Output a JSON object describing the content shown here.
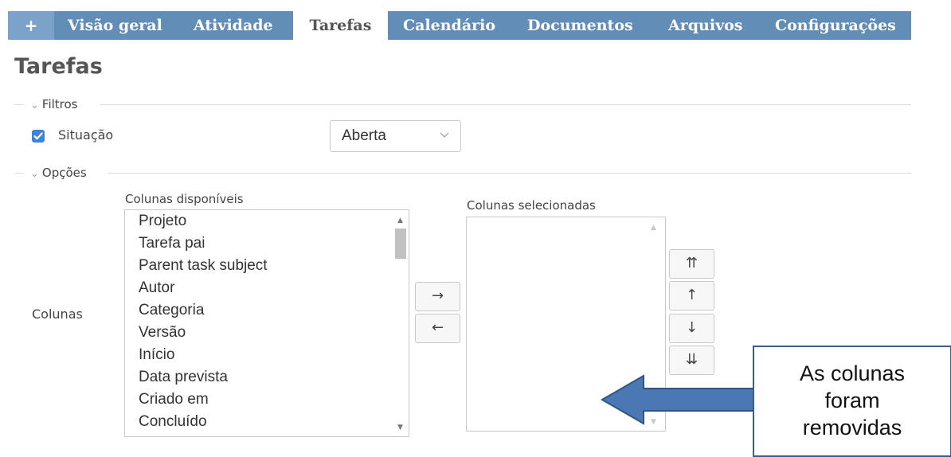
{
  "tabs": [
    {
      "label": "+"
    },
    {
      "label": "Visão geral"
    },
    {
      "label": "Atividade"
    },
    {
      "label": "Tarefas",
      "active": true
    },
    {
      "label": "Calendário"
    },
    {
      "label": "Documentos"
    },
    {
      "label": "Arquivos"
    },
    {
      "label": "Configurações"
    }
  ],
  "page_title": "Tarefas",
  "filters": {
    "legend": "Filtros",
    "status_label": "Situação",
    "status_checked": true,
    "status_value": "Aberta"
  },
  "options": {
    "legend": "Opções",
    "columns_label": "Colunas",
    "available_label": "Colunas disponíveis",
    "selected_label": "Colunas selecionadas",
    "available_columns": [
      "Projeto",
      "Tarefa pai",
      "Parent task subject",
      "Autor",
      "Categoria",
      "Versão",
      "Início",
      "Data prevista",
      "Criado em",
      "Concluído"
    ],
    "selected_columns": [],
    "move_right": "→",
    "move_left": "←",
    "move_top": "⇈",
    "move_up": "↑",
    "move_down": "↓",
    "move_bottom": "⇊"
  },
  "annotation": {
    "lines": [
      "As colunas",
      "foram",
      "removidas"
    ]
  },
  "colors": {
    "tabbar": "#628db6",
    "checkbox": "#3d83d9",
    "annotation_arrow": "#4a78b5"
  }
}
